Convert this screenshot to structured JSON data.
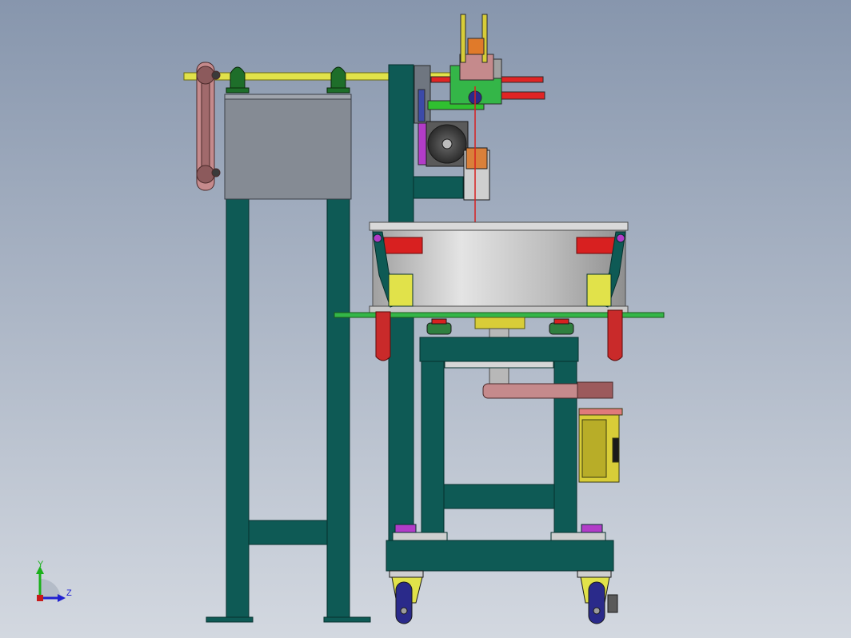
{
  "viewport": {
    "background_top": "#8796ad",
    "background_bottom": "#d3d8e0"
  },
  "colors": {
    "frame": "#0e5a55",
    "frame_edge": "#06302d",
    "shaft": "#e1e24a",
    "housing": "#858b94",
    "belt": "#c58a8c",
    "drum_light": "#d9d9d9",
    "drum_dark": "#9c9c9c",
    "red": "#d82020",
    "green_plate": "#34b648",
    "rail_red": "#e02424",
    "rail_green": "#30c030",
    "motor": "#d8cd38",
    "magenta": "#b23cc8",
    "wheel": "#2a2a8a",
    "clamp_red": "#c92a2a"
  },
  "triad": {
    "y_label": "Y",
    "z_label": "Z"
  }
}
